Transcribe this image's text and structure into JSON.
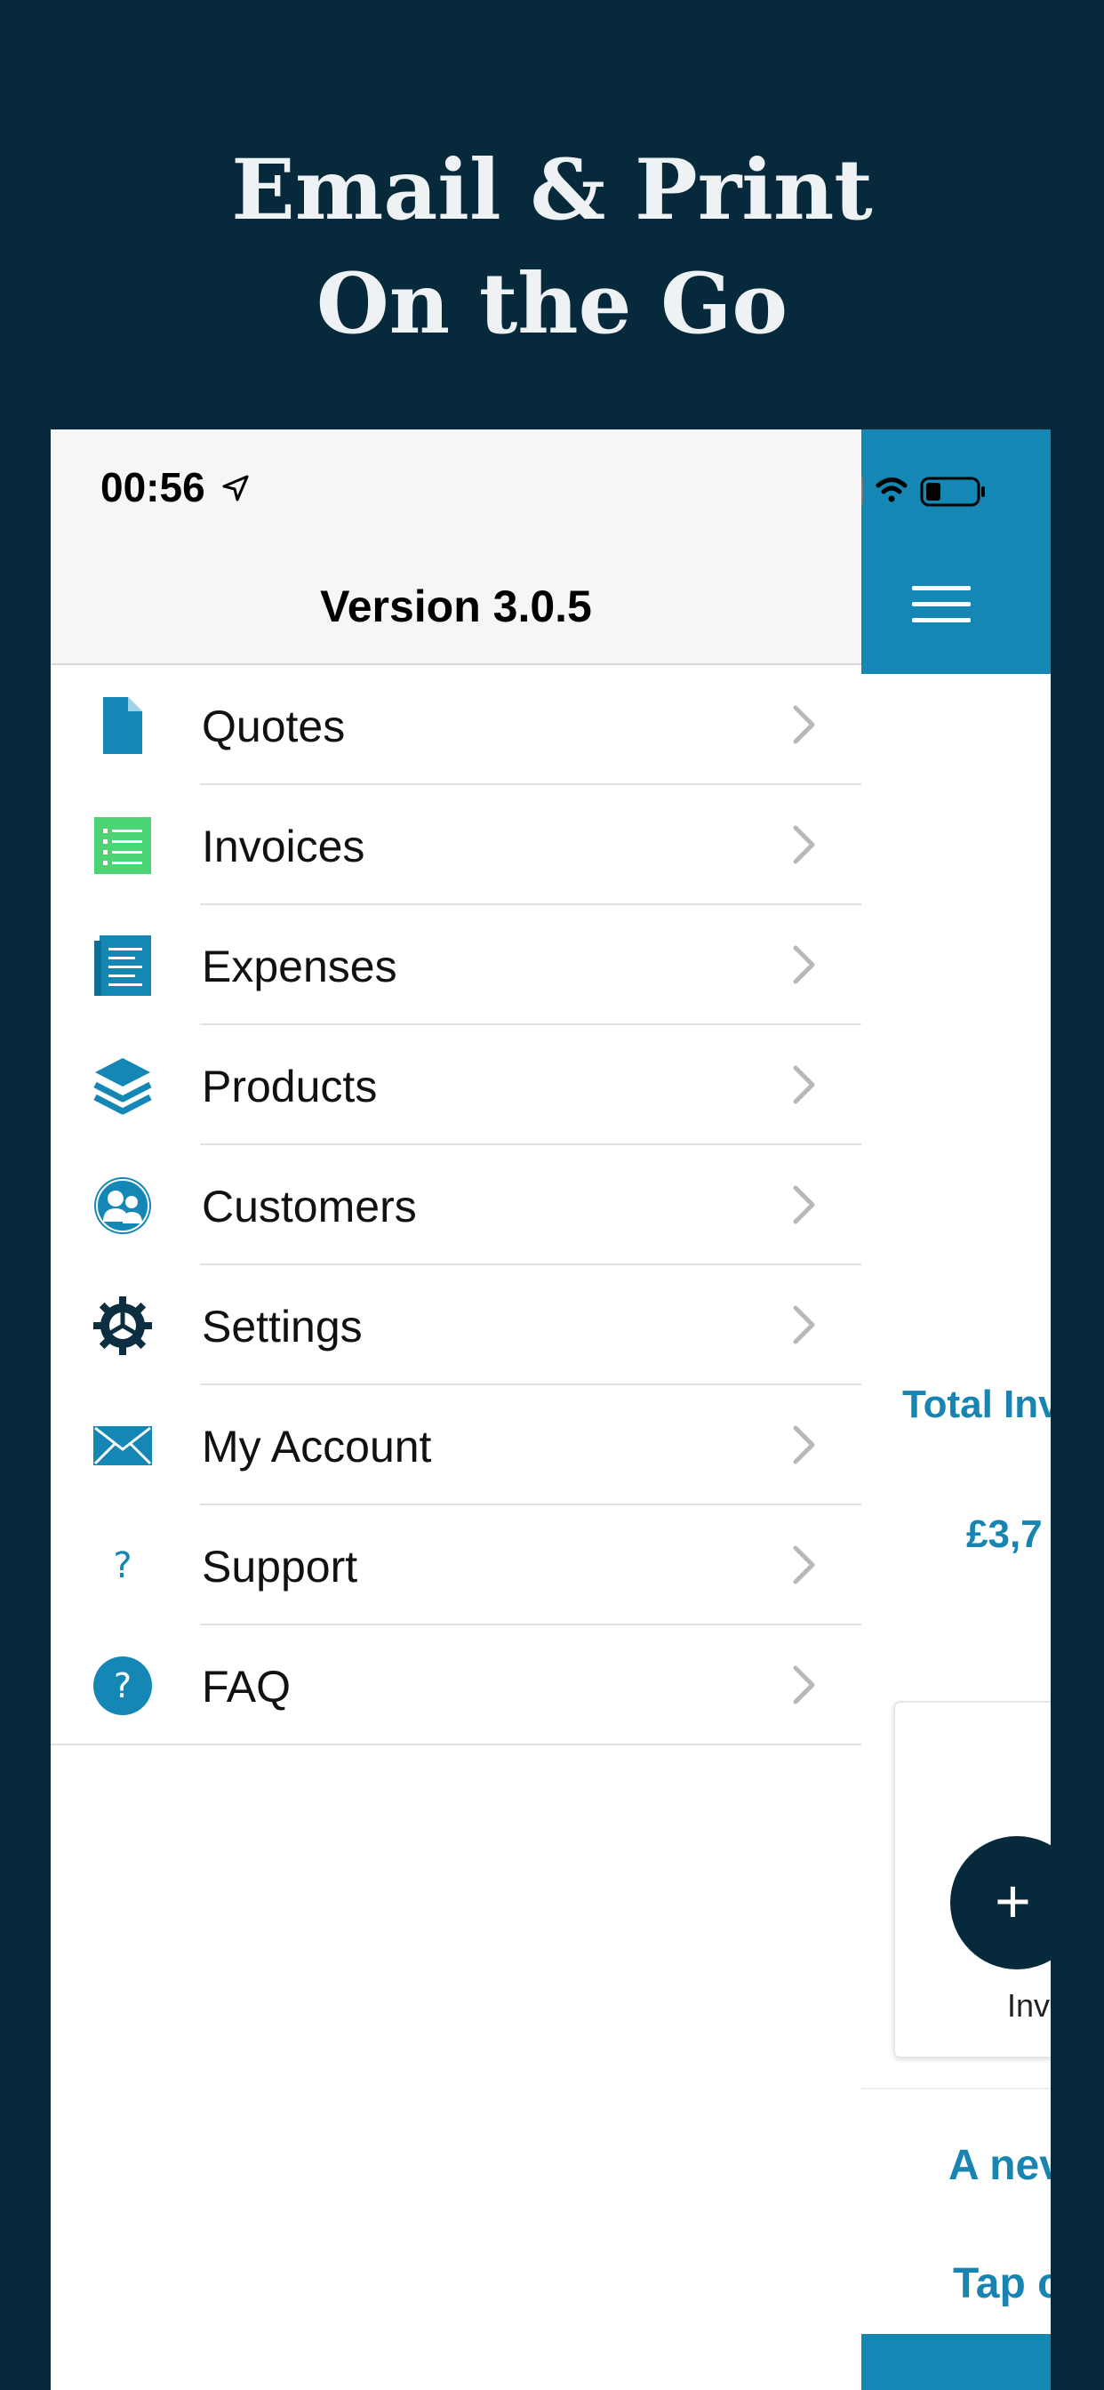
{
  "headline": {
    "line1": "Email & Print",
    "line2": "On the Go"
  },
  "status_bar": {
    "time": "00:56"
  },
  "drawer": {
    "version": "Version 3.0.5",
    "items": [
      {
        "label": "Quotes",
        "icon": "document-icon"
      },
      {
        "label": "Invoices",
        "icon": "list-icon"
      },
      {
        "label": "Expenses",
        "icon": "receipt-icon"
      },
      {
        "label": "Products",
        "icon": "layers-icon"
      },
      {
        "label": "Customers",
        "icon": "people-icon"
      },
      {
        "label": "Settings",
        "icon": "gear-icon"
      },
      {
        "label": "My Account",
        "icon": "envelope-icon"
      },
      {
        "label": "Support",
        "icon": "question-icon"
      },
      {
        "label": "FAQ",
        "icon": "question-circle-icon"
      }
    ]
  },
  "background_screen": {
    "total_label": "Total Inv",
    "total_value": "£3,7",
    "card_label": "Inv",
    "promo_line1": "A nev",
    "promo_line2": "Tap c"
  },
  "colors": {
    "page_background": "#062a3c",
    "accent_blue": "#1487b4",
    "text_blue": "#1784b2",
    "invoices_green": "#4cd474"
  }
}
